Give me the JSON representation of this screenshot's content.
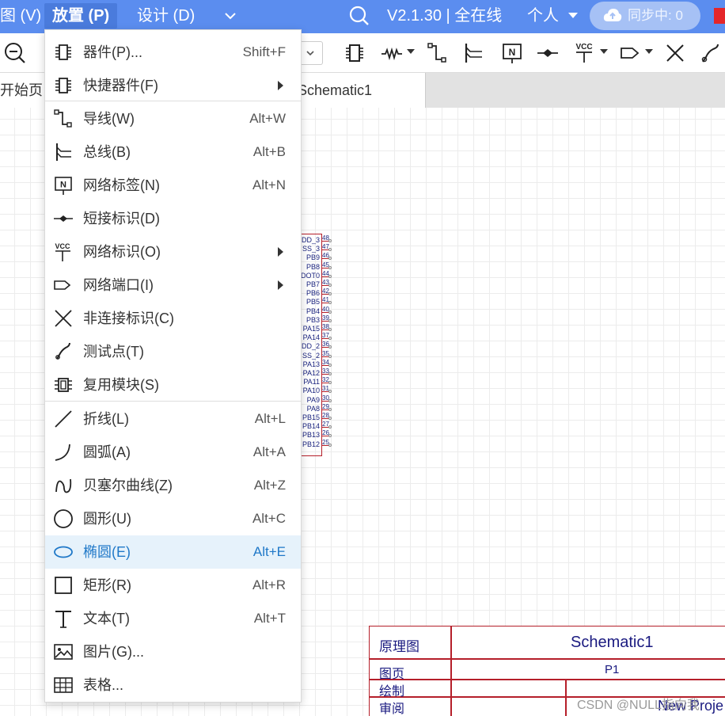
{
  "menubar": {
    "items": [
      "图 (V)",
      "放置 (P)",
      "设计 (D)"
    ],
    "version": "V2.1.30 | 全在线",
    "user": "个人",
    "sync_label": "同步中: 0",
    "colors": {
      "bar": "#5b8def",
      "active": "#4a7bdc"
    }
  },
  "toolbar": {
    "icons": [
      "zoom-out-icon",
      "component-icon",
      "resistor-icon",
      "wire-icon",
      "bus-icon",
      "net-label-icon",
      "short-flag-icon",
      "vcc-icon",
      "net-port-icon",
      "no-connect-icon",
      "probe-icon"
    ],
    "vcc_text": "VCC",
    "netlabel_text": "N"
  },
  "tabs": {
    "start": "开始页",
    "schematic": "Schematic1"
  },
  "menu": {
    "items": [
      {
        "label": "器件(P)...",
        "shortcut": "Shift+F",
        "icon": "component-icon"
      },
      {
        "label": "快捷器件(F)",
        "shortcut": "",
        "submenu": true,
        "icon": "component-icon"
      },
      {
        "label": "导线(W)",
        "shortcut": "Alt+W",
        "icon": "wire-icon"
      },
      {
        "label": "总线(B)",
        "shortcut": "Alt+B",
        "icon": "bus-icon"
      },
      {
        "label": "网络标签(N)",
        "shortcut": "Alt+N",
        "icon": "net-label-icon"
      },
      {
        "label": "短接标识(D)",
        "shortcut": "",
        "icon": "short-flag-icon"
      },
      {
        "label": "网络标识(O)",
        "shortcut": "",
        "submenu": true,
        "icon": "vcc-icon"
      },
      {
        "label": "网络端口(I)",
        "shortcut": "",
        "submenu": true,
        "icon": "net-port-icon"
      },
      {
        "label": "非连接标识(C)",
        "shortcut": "",
        "icon": "no-connect-icon"
      },
      {
        "label": "测试点(T)",
        "shortcut": "",
        "icon": "probe-icon"
      },
      {
        "label": "复用模块(S)",
        "shortcut": "",
        "icon": "module-icon"
      },
      {
        "label": "折线(L)",
        "shortcut": "Alt+L",
        "icon": "polyline-icon"
      },
      {
        "label": "圆弧(A)",
        "shortcut": "Alt+A",
        "icon": "arc-icon"
      },
      {
        "label": "贝塞尔曲线(Z)",
        "shortcut": "Alt+Z",
        "icon": "bezier-icon"
      },
      {
        "label": "圆形(U)",
        "shortcut": "Alt+C",
        "icon": "circle-icon"
      },
      {
        "label": "椭圆(E)",
        "shortcut": "Alt+E",
        "icon": "ellipse-icon",
        "active": true
      },
      {
        "label": "矩形(R)",
        "shortcut": "Alt+R",
        "icon": "rectangle-icon"
      },
      {
        "label": "文本(T)",
        "shortcut": "Alt+T",
        "icon": "text-icon"
      },
      {
        "label": "图片(G)...",
        "shortcut": "",
        "icon": "image-icon"
      },
      {
        "label": "表格...",
        "shortcut": "",
        "icon": "table-icon"
      }
    ]
  },
  "component": {
    "pins": [
      {
        "name": "DD_3",
        "num": "48"
      },
      {
        "name": "SS_3",
        "num": "47"
      },
      {
        "name": "PB9",
        "num": "46"
      },
      {
        "name": "PB8",
        "num": "45"
      },
      {
        "name": "DOT0",
        "num": "44"
      },
      {
        "name": "PB7",
        "num": "43"
      },
      {
        "name": "PB6",
        "num": "42"
      },
      {
        "name": "PB5",
        "num": "41"
      },
      {
        "name": "PB4",
        "num": "40"
      },
      {
        "name": "PB3",
        "num": "39"
      },
      {
        "name": "PA15",
        "num": "38"
      },
      {
        "name": "PA14",
        "num": "37"
      },
      {
        "name": "DD_2",
        "num": "36"
      },
      {
        "name": "SS_2",
        "num": "35"
      },
      {
        "name": "PA13",
        "num": "34"
      },
      {
        "name": "PA12",
        "num": "33"
      },
      {
        "name": "PA11",
        "num": "32"
      },
      {
        "name": "PA10",
        "num": "31"
      },
      {
        "name": "PA9",
        "num": "30"
      },
      {
        "name": "PA8",
        "num": "29"
      },
      {
        "name": "PB15",
        "num": "28"
      },
      {
        "name": "PB14",
        "num": "27"
      },
      {
        "name": "PB13",
        "num": "26"
      },
      {
        "name": "PB12",
        "num": "25"
      }
    ]
  },
  "titleblock": {
    "type_label": "原理图",
    "name": "Schematic1",
    "page_label": "图页",
    "page_value": "P1",
    "drawn_label": "绘制",
    "review_label": "审阅",
    "project": "New Proje"
  },
  "watermark": "CSDN @NULL指向我"
}
